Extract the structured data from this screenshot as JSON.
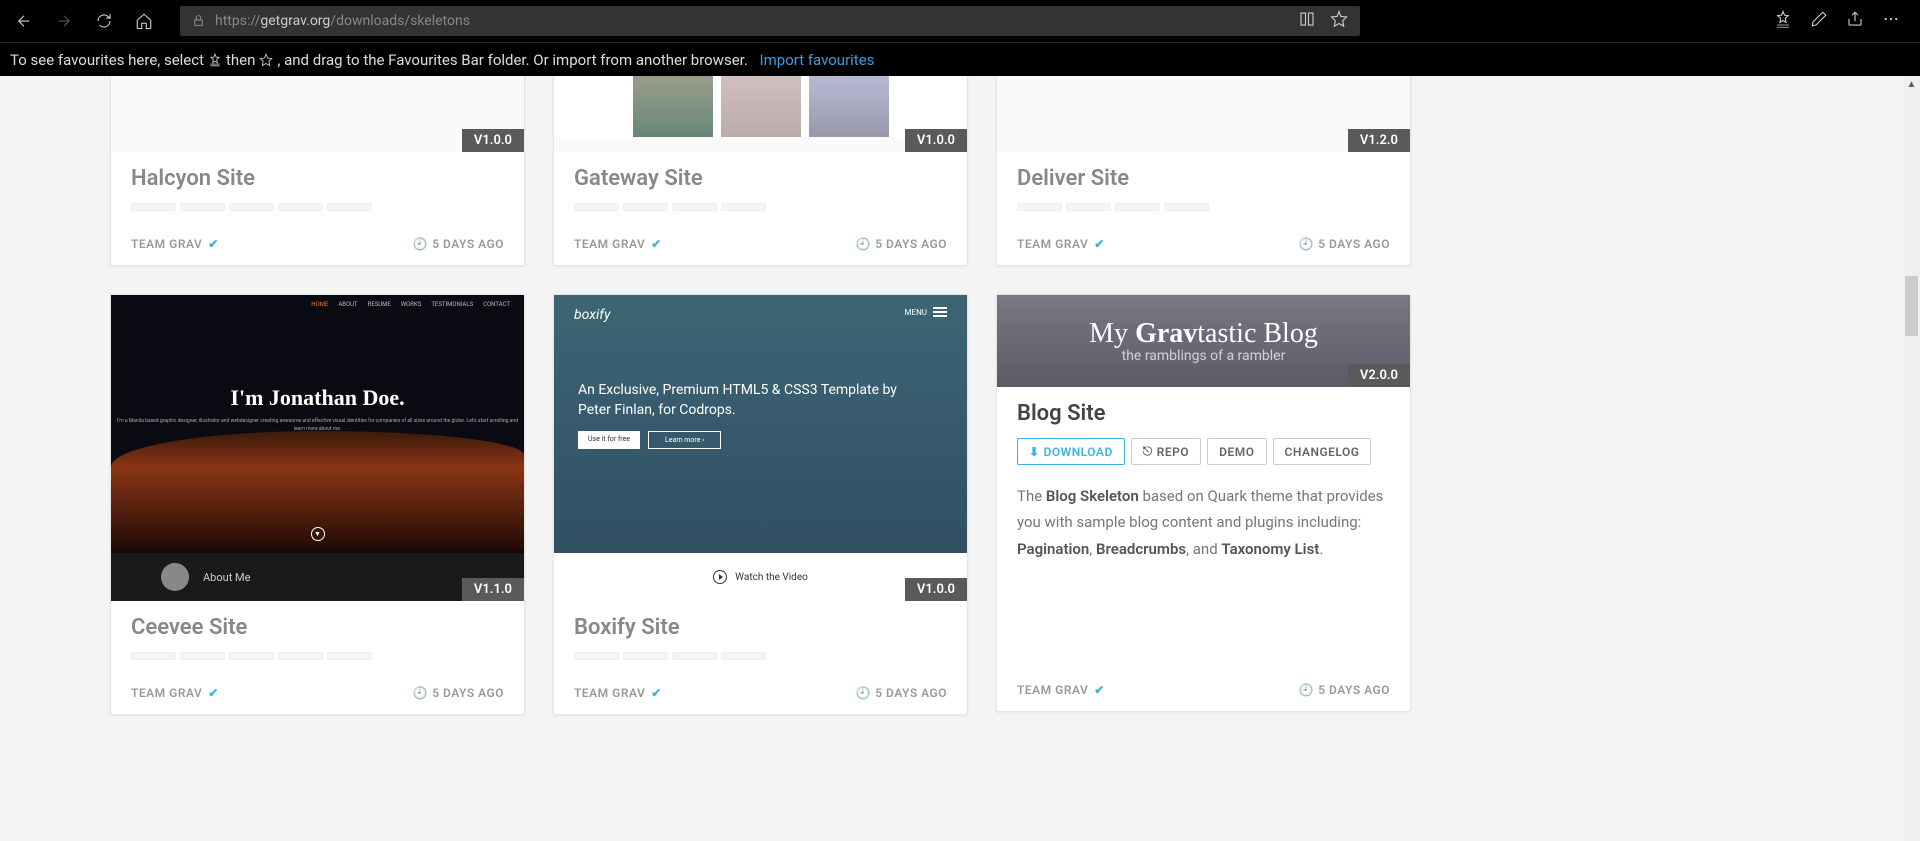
{
  "browser": {
    "url_protocol": "https://",
    "url_domain": "getgrav.org",
    "url_path": "/downloads/skeletons"
  },
  "fav_bar": {
    "text_1": "To see favourites here, select",
    "text_2": "then",
    "text_3": ", and drag to the Favourites Bar folder. Or import from another browser.",
    "link": "Import favourites"
  },
  "cards": {
    "halcyon": {
      "title": "Halcyon Site",
      "version": "V1.0.0",
      "team": "TEAM GRAV",
      "time": "5 DAYS AGO"
    },
    "gateway": {
      "title": "Gateway Site",
      "version": "V1.0.0",
      "team": "TEAM GRAV",
      "time": "5 DAYS AGO"
    },
    "deliver": {
      "title": "Deliver Site",
      "version": "V1.2.0",
      "team": "TEAM GRAV",
      "time": "5 DAYS AGO"
    },
    "ceevee": {
      "title": "Ceevee Site",
      "version": "V1.1.0",
      "team": "TEAM GRAV",
      "time": "5 DAYS AGO"
    },
    "boxify": {
      "title": "Boxify Site",
      "version": "V1.0.0",
      "team": "TEAM GRAV",
      "time": "5 DAYS AGO"
    },
    "blog": {
      "title": "Blog Site",
      "version": "V2.0.0",
      "team": "TEAM GRAV",
      "time": "5 DAYS AGO",
      "download": "DOWNLOAD",
      "repo": "REPO",
      "demo": "DEMO",
      "changelog": "CHANGELOG",
      "desc_1": "The ",
      "desc_b1": "Blog Skeleton",
      "desc_2": " based on Quark theme that provides you with sample blog content and plugins including: ",
      "desc_b2": "Pagination",
      "desc_3": ", ",
      "desc_b3": "Breadcrumbs",
      "desc_4": ", and ",
      "desc_b4": "Taxonomy List",
      "desc_5": "."
    }
  },
  "thumbs": {
    "ceevee": {
      "nav": [
        "HOME",
        "ABOUT",
        "RESUME",
        "WORKS",
        "TESTIMONIALS",
        "CONTACT"
      ],
      "heading": "I'm Jonathan Doe.",
      "sub": "I'm a Manila based graphic designer, illustrator and webdesigner creating awesome and effective visual identities for companies of all sizes around the globe. Let's start scrolling and learn more about me.",
      "about": "About Me"
    },
    "boxify": {
      "logo": "boxify",
      "menu": "MENU",
      "tagline1": "An Exclusive, Premium HTML5 & CSS3 Template by",
      "tagline2": "Peter Finlan, for Codrops.",
      "btn1": "Use it for free",
      "btn2": "Learn more  ›",
      "video": "Watch the Video"
    },
    "blog": {
      "h1_a": "My ",
      "h1_b": "Grav",
      "h1_c": "tastic Blog",
      "sub": "the ramblings of a rambler"
    }
  }
}
